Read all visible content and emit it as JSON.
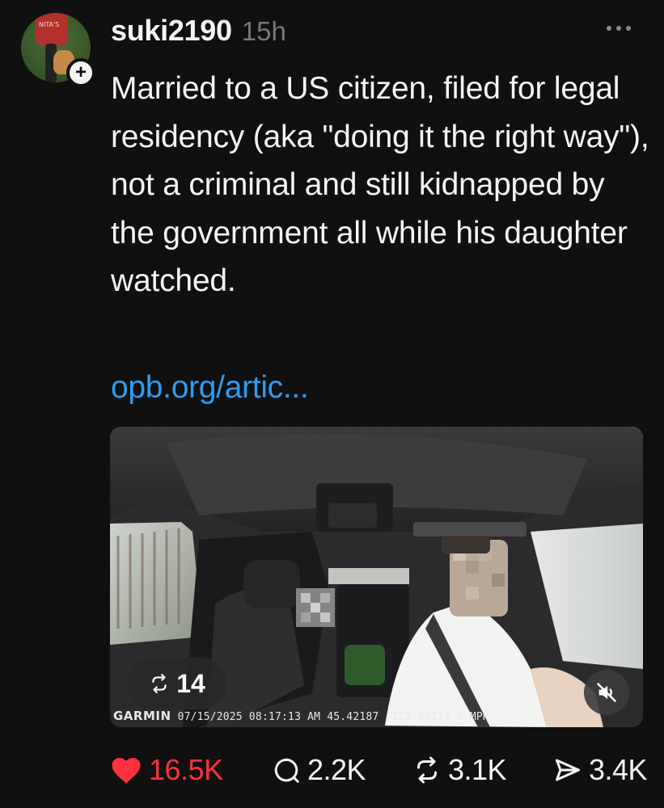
{
  "post": {
    "username": "suki2190",
    "timestamp": "15h",
    "text": "Married to a US citizen, filed for legal residency (aka \"doing it the right way\"), not a criminal and still kidnapped by the government all while his daughter watched.",
    "link_text": "opb.org/artic..."
  },
  "avatar": {
    "shirt_text": "NITA'S"
  },
  "media": {
    "repost_count": "14",
    "overlay": {
      "brand": "GARMIN",
      "date": "07/15/2025",
      "time": "08:17:13 AM",
      "coords": "45.42187 -122.80114",
      "speed": "0 MPH"
    },
    "mute_icon": "speaker-muted-icon"
  },
  "actions": {
    "likes": "16.5K",
    "replies": "2.2K",
    "reposts": "3.1K",
    "shares": "3.4K"
  },
  "colors": {
    "background": "#101010",
    "text": "#f3f5f7",
    "muted": "#777777",
    "link": "#2e9bf0",
    "like": "#ff3040"
  }
}
